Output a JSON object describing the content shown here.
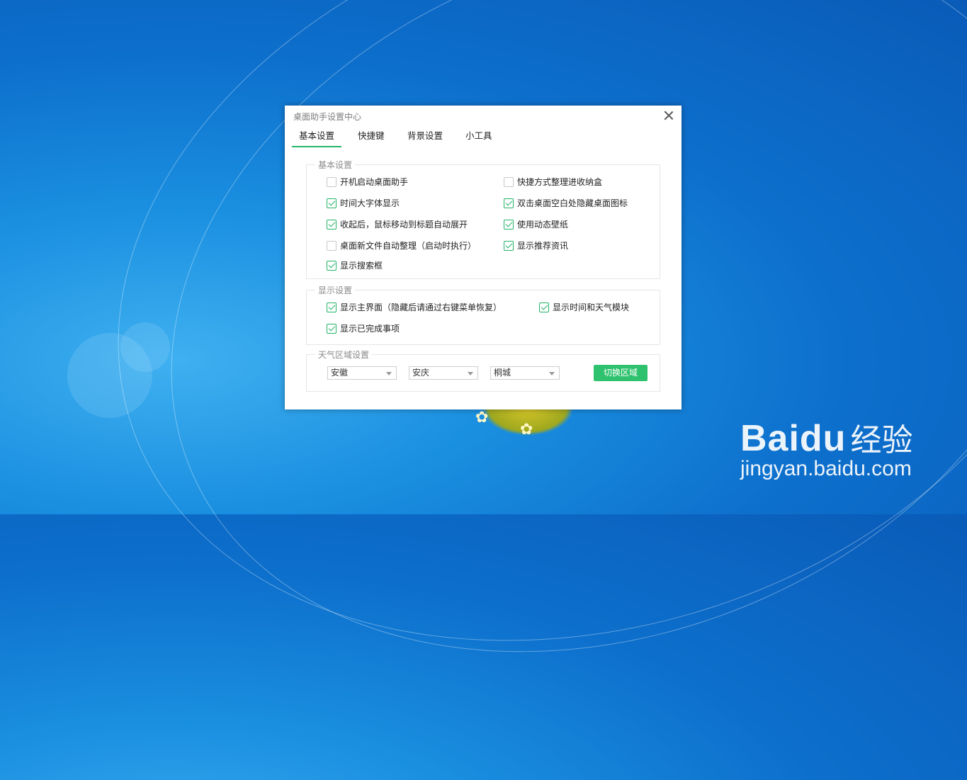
{
  "window": {
    "title": "桌面助手设置中心"
  },
  "tabs": [
    {
      "label": "基本设置",
      "active": true
    },
    {
      "label": "快捷键",
      "active": false
    },
    {
      "label": "背景设置",
      "active": false
    },
    {
      "label": "小工具",
      "active": false
    }
  ],
  "basic": {
    "legend": "基本设置",
    "options": [
      {
        "label": "开机启动桌面助手",
        "checked": false
      },
      {
        "label": "快捷方式整理进收纳盒",
        "checked": false
      },
      {
        "label": "时间大字体显示",
        "checked": true
      },
      {
        "label": "双击桌面空白处隐藏桌面图标",
        "checked": true
      },
      {
        "label": "收起后，鼠标移动到标题自动展开",
        "checked": true
      },
      {
        "label": "使用动态壁纸",
        "checked": true
      },
      {
        "label": "桌面新文件自动整理（启动时执行）",
        "checked": false
      },
      {
        "label": "显示推荐资讯",
        "checked": true
      },
      {
        "label": "显示搜索框",
        "checked": true
      }
    ]
  },
  "display": {
    "legend": "显示设置",
    "options": [
      {
        "label": "显示主界面（隐藏后请通过右键菜单恢复）",
        "checked": true
      },
      {
        "label": "显示时间和天气模块",
        "checked": true
      },
      {
        "label": "显示已完成事项",
        "checked": true
      }
    ]
  },
  "weather": {
    "legend": "天气区域设置",
    "province": "安徽",
    "city": "安庆",
    "county": "桐城",
    "switch_label": "切换区域"
  },
  "watermark": {
    "logo_a": "Bai",
    "logo_b": "du",
    "cn": "经验",
    "url": "jingyan.baidu.com"
  },
  "colors": {
    "accent": "#23b368",
    "button": "#2fc26e",
    "desktop": "#0d6fcc"
  }
}
